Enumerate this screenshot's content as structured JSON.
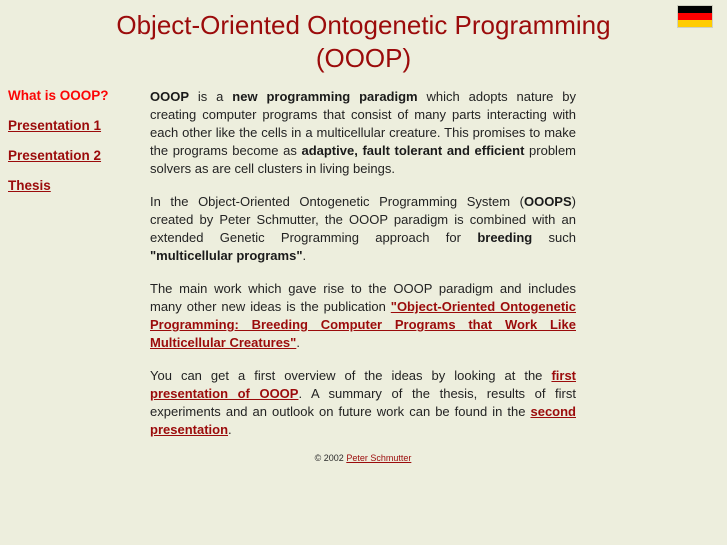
{
  "page": {
    "title_line1": "Object-Oriented Ontogenetic Programming",
    "title_line2": "(OOOP)",
    "background_color": "#edeedd",
    "title_color": "#9b0b0b",
    "link_color": "#9b0b0b",
    "active_nav_color": "#fb0505",
    "body_text_color": "#232323"
  },
  "flag": {
    "name": "german-flag",
    "bands": [
      "#000000",
      "#ff0000",
      "#ffcc00"
    ]
  },
  "sidebar": {
    "items": [
      {
        "label": "What is OOOP?",
        "active": true
      },
      {
        "label": "Presentation 1",
        "active": false
      },
      {
        "label": "Presentation 2",
        "active": false
      },
      {
        "label": "Thesis",
        "active": false
      }
    ]
  },
  "content": {
    "p1": {
      "t1": "OOOP",
      "t2": " is a ",
      "t3": "new programming paradigm",
      "t4": " which adopts nature by creating computer programs that consist of many parts interacting with each other like the cells in a multicellular creature. This promises to make the programs become as ",
      "t5": "adaptive, fault tolerant and efficient",
      "t6": " problem solvers as are cell clusters in living beings."
    },
    "p2": {
      "t1": "In the Object-Oriented Ontogenetic Programming System (",
      "t2": "OOOPS",
      "t3": ") created by Peter Schmutter, the OOOP paradigm is combined with an extended Genetic Programming approach for ",
      "t4": "breeding",
      "t5": " such ",
      "t6": "\"multicellular programs\"",
      "t7": "."
    },
    "p3": {
      "t1": "The main work which gave rise to the OOOP paradigm and includes many other new ideas is the publication ",
      "link": "\"Object-Oriented Ontogenetic Programming: Breeding Computer Programs that Work Like Multicellular Creatures\"",
      "t2": "."
    },
    "p4": {
      "t1": "You can get a first overview of the ideas by looking at the ",
      "link1": "first presentation of OOOP",
      "t2": ". A summary of the thesis, results of first experiments and an outlook on future work can be found in the ",
      "link2": "second presentation",
      "t3": "."
    }
  },
  "footer": {
    "copyright": "© 2002 ",
    "author": "Peter Schmutter"
  }
}
